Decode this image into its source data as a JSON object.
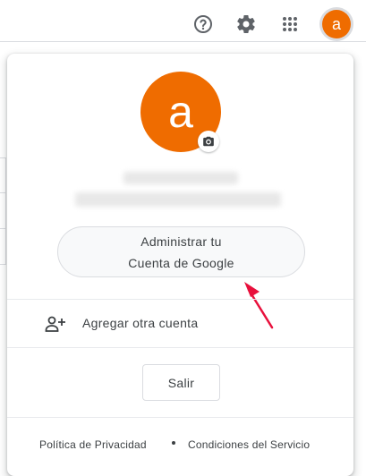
{
  "header": {
    "help_icon": "help-circle-icon",
    "settings_icon": "gear-icon",
    "apps_icon": "apps-grid-icon",
    "avatar_letter": "a",
    "avatar_color": "#ef6c00"
  },
  "account_menu": {
    "avatar_letter": "a",
    "avatar_color": "#ef6c00",
    "camera_icon": "camera-icon",
    "manage_button": {
      "line1": "Administrar tu",
      "line2": "Cuenta de Google"
    },
    "add_account": {
      "icon": "person-add-icon",
      "label": "Agregar otra cuenta"
    },
    "logout_label": "Salir",
    "footer": {
      "privacy": "Política de Privacidad",
      "terms": "Condiciones del Servicio"
    }
  },
  "annotation": {
    "arrow_color": "#e8103c"
  }
}
